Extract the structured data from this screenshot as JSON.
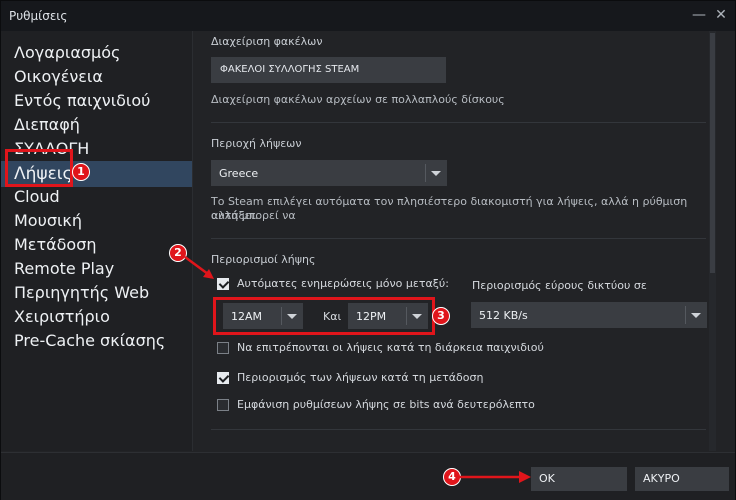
{
  "window": {
    "title": "Ρυθμίσεις"
  },
  "sidebar": {
    "items": [
      {
        "label": "Λογαριασμός"
      },
      {
        "label": "Οικογένεια"
      },
      {
        "label": "Εντός παιχνιδιού"
      },
      {
        "label": "Διεπαφή"
      },
      {
        "label": "ΣΥΛΛΟΓΗ"
      },
      {
        "label": "Λήψεις"
      },
      {
        "label": "Cloud"
      },
      {
        "label": "Μουσική"
      },
      {
        "label": "Μετάδοση"
      },
      {
        "label": "Remote Play"
      },
      {
        "label": "Περιηγητής Web"
      },
      {
        "label": "Χειριστήριο"
      },
      {
        "label": "Pre-Cache σκίασης"
      }
    ],
    "active": "Λήψεις"
  },
  "folders": {
    "heading": "Διαχείριση φακέλων",
    "button": "ΦΑΚΕΛΟΙ ΣΥΛΛΟΓΗΣ STEAM",
    "note": "Διαχείριση φακέλων αρχείων σε πολλαπλούς δίσκους"
  },
  "region": {
    "heading": "Περιοχή λήψεων",
    "selected": "Greece",
    "note_line1": "Το Steam επιλέγει αυτόματα τον πλησιέστερο διακομιστή για λήψεις, αλλά η ρύθμιση αυτή μπορεί να",
    "note_line2": "αλλάξει."
  },
  "limits": {
    "heading": "Περιορισμοί λήψης",
    "auto_update_label": "Αυτόματες ενημερώσεις μόνο μεταξύ:",
    "auto_update_checked": true,
    "start_time": "12AM",
    "and_label": "Και",
    "end_time": "12PM",
    "bandwidth_label": "Περιορισμός εύρους δικτύου σε",
    "bandwidth_value": "512 KB/s",
    "options": [
      {
        "label": "Να επιτρέπονται οι λήψεις κατά τη διάρκεια παιχνιδιού",
        "checked": false
      },
      {
        "label": "Περιορισμός των λήψεων κατά τη μετάδοση",
        "checked": true
      },
      {
        "label": "Εμφάνιση ρυθμίσεων λήψης σε bits ανά δευτερόλεπτο",
        "checked": false
      }
    ]
  },
  "footer": {
    "ok": "OK",
    "cancel": "ΑΚΥΡΟ"
  },
  "annotations": {
    "badge1": "1",
    "badge2": "2",
    "badge3": "3",
    "badge4": "4",
    "color": "#e0151b"
  }
}
